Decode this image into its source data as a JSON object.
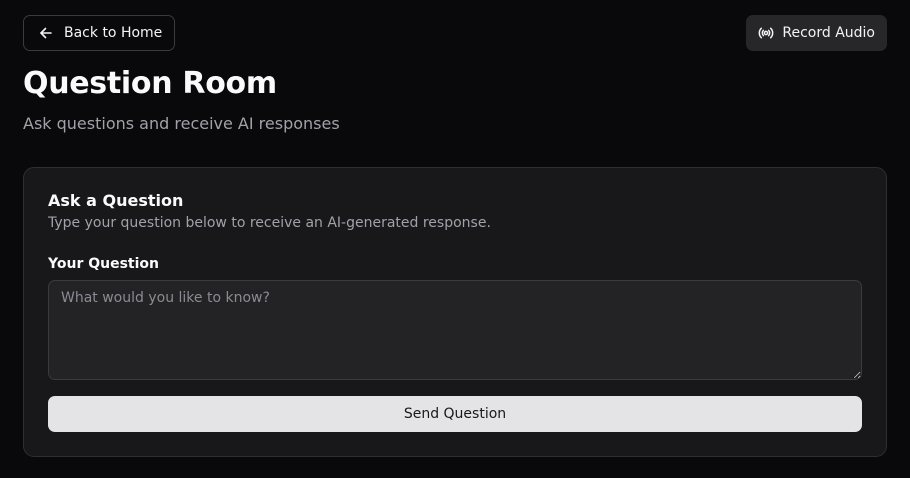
{
  "header": {
    "back_label": "Back to Home",
    "back_icon": "arrow-left-icon",
    "record_label": "Record Audio",
    "record_icon": "radio-broadcast-icon"
  },
  "main": {
    "title": "Question Room",
    "subtitle": "Ask questions and receive AI responses"
  },
  "card": {
    "title": "Ask a Question",
    "description": "Type your question below to receive an AI-generated response.",
    "field_label": "Your Question",
    "input_value": "",
    "input_placeholder": "What would you like to know?",
    "submit_label": "Send Question"
  },
  "colors": {
    "background": "#09090b",
    "card": "#18181b",
    "primary_button": "#e4e4e7",
    "muted_text": "#a1a1aa"
  }
}
